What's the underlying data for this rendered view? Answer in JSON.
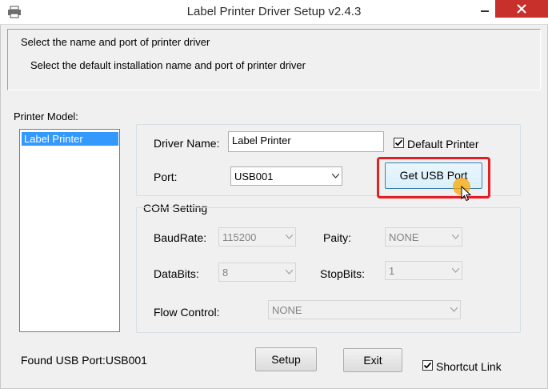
{
  "window": {
    "title": "Label Printer Driver Setup v2.4.3",
    "close_glyph": "✕",
    "minimize_glyph": "—"
  },
  "header": {
    "heading": "Select the name and port of printer driver",
    "subheading": "Select the default installation name and port of printer driver"
  },
  "printer_model": {
    "label": "Printer Model:",
    "items": [
      "Label Printer"
    ],
    "selected": "Label Printer"
  },
  "driver": {
    "name_label": "Driver Name:",
    "name_value": "Label Printer",
    "default_printer_label": "Default Printer",
    "default_printer_checked": true,
    "port_label": "Port:",
    "port_value": "USB001",
    "get_usb_button": "Get USB Port"
  },
  "com_setting": {
    "title": "COM Setting",
    "baudrate_label": "BaudRate:",
    "baudrate_value": "115200",
    "parity_label": "Paity:",
    "parity_value": "NONE",
    "databits_label": "DataBits:",
    "databits_value": "8",
    "stopbits_label": "StopBits:",
    "stopbits_value": "1",
    "flow_label": "Flow Control:",
    "flow_value": "NONE"
  },
  "footer": {
    "status": "Found USB Port:USB001",
    "setup_button": "Setup",
    "exit_button": "Exit",
    "shortcut_label": "Shortcut Link",
    "shortcut_checked": true
  },
  "colors": {
    "close_button": "#c7302b",
    "selection": "#3399ff",
    "highlight_box": "#e31e24",
    "cursor_halo": "#ffa500"
  }
}
